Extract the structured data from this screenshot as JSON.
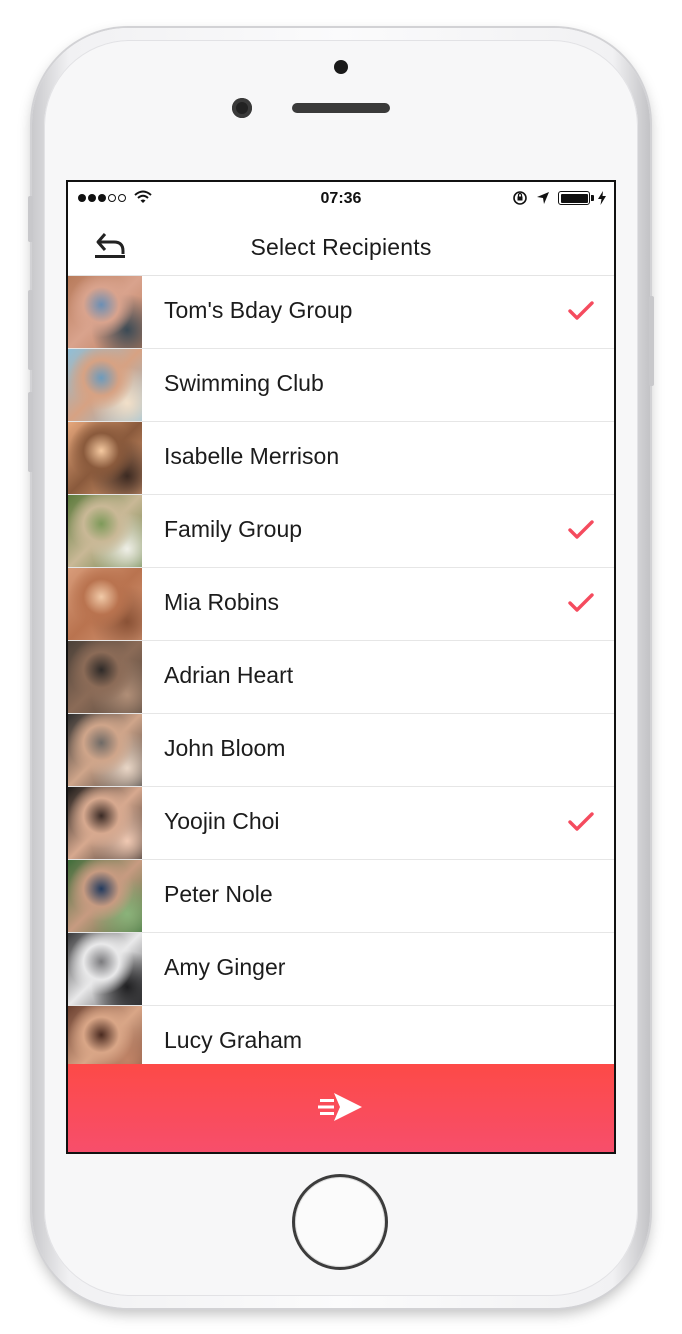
{
  "status_bar": {
    "time": "07:36",
    "signal_bars": 3,
    "signal_total": 5,
    "battery_level": 1.0
  },
  "header": {
    "title": "Select Recipients",
    "back_icon": "back-arrow-icon"
  },
  "recipients": [
    {
      "name": "Tom's Bday Group",
      "selected": true,
      "avatar_colors": [
        "#b77a5a",
        "#d9a38d",
        "#6b8fb5",
        "#3b4a55"
      ]
    },
    {
      "name": "Swimming Club",
      "selected": false,
      "avatar_colors": [
        "#8fbfd8",
        "#d7a283",
        "#6c9bbd",
        "#f2e0c9"
      ]
    },
    {
      "name": "Isabelle Merrison",
      "selected": false,
      "avatar_colors": [
        "#e6a77c",
        "#8a5a3c",
        "#f5c9a0",
        "#3c2a22"
      ]
    },
    {
      "name": "Family Group",
      "selected": true,
      "avatar_colors": [
        "#5c7a3c",
        "#c9b896",
        "#7e9a5a",
        "#efefe7"
      ]
    },
    {
      "name": "Mia Robins",
      "selected": true,
      "avatar_colors": [
        "#d89c7a",
        "#b9734f",
        "#f1caa8",
        "#8a5236"
      ]
    },
    {
      "name": "Adrian Heart",
      "selected": false,
      "avatar_colors": [
        "#4a4038",
        "#8b6b57",
        "#2e2a28",
        "#b08e77"
      ]
    },
    {
      "name": "John Bloom",
      "selected": false,
      "avatar_colors": [
        "#2f2f2f",
        "#cfa58a",
        "#6f6a66",
        "#e9d6c6"
      ]
    },
    {
      "name": "Yoojin Choi",
      "selected": true,
      "avatar_colors": [
        "#1d1a19",
        "#d7a98f",
        "#3a2a25",
        "#f0c9b3"
      ]
    },
    {
      "name": "Peter Nole",
      "selected": false,
      "avatar_colors": [
        "#3f6d3a",
        "#c79b81",
        "#223a5e",
        "#8ab37a"
      ]
    },
    {
      "name": "Amy Ginger",
      "selected": false,
      "avatar_colors": [
        "#3a3a3c",
        "#e9e9ea",
        "#7b7b7e",
        "#1f1f21"
      ]
    },
    {
      "name": "Lucy Graham",
      "selected": false,
      "avatar_colors": [
        "#6b4030",
        "#d9a687",
        "#4a2a20",
        "#c08366"
      ]
    }
  ],
  "send_button": {
    "icon": "send-arrow-icon"
  },
  "colors": {
    "accent": "#f54b5e",
    "send_gradient_top": "#fd4a47",
    "send_gradient_bottom": "#f74e6b"
  }
}
